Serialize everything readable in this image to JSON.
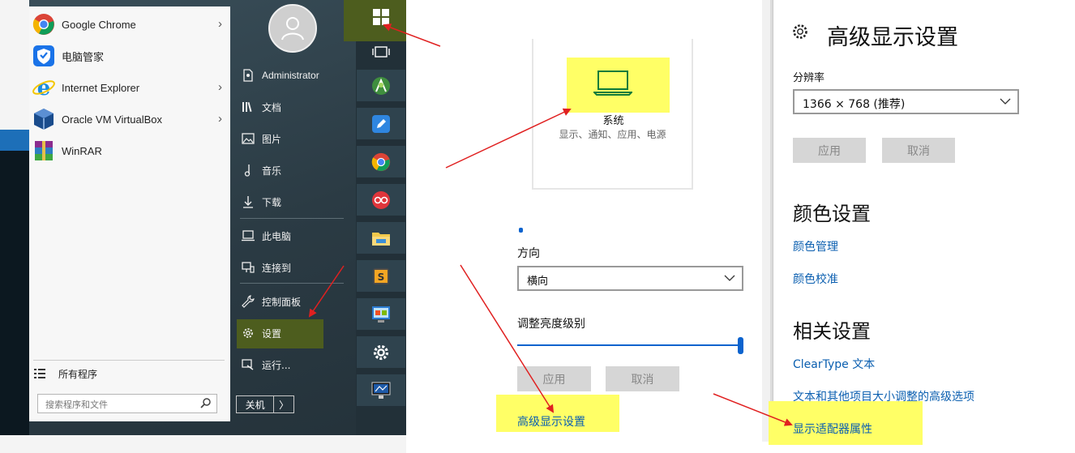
{
  "start_menu": {
    "apps": [
      {
        "label": "Google Chrome",
        "icon": "chrome-icon",
        "has_submenu": true
      },
      {
        "label": "电脑管家",
        "icon": "pc-manager-icon",
        "has_submenu": false
      },
      {
        "label": "Internet Explorer",
        "icon": "ie-icon",
        "has_submenu": true
      },
      {
        "label": "Oracle VM VirtualBox",
        "icon": "virtualbox-icon",
        "has_submenu": true
      },
      {
        "label": "WinRAR",
        "icon": "winrar-icon",
        "has_submenu": false
      }
    ],
    "all_programs": "所有程序",
    "search_placeholder": "搜索程序和文件",
    "right_items": [
      {
        "label": "Administrator",
        "icon": "user-doc-icon"
      },
      {
        "label": "文档",
        "icon": "library-icon"
      },
      {
        "label": "图片",
        "icon": "picture-icon"
      },
      {
        "label": "音乐",
        "icon": "music-icon"
      },
      {
        "label": "下载",
        "icon": "download-icon"
      },
      {
        "label": "此电脑",
        "icon": "computer-icon"
      },
      {
        "label": "连接到",
        "icon": "connect-icon"
      },
      {
        "label": "控制面板",
        "icon": "wrench-icon"
      },
      {
        "label": "设置",
        "icon": "gear-icon"
      },
      {
        "label": "运行...",
        "icon": "run-icon"
      }
    ],
    "shutdown_label": "关机",
    "shutdown_arrow": "〉"
  },
  "taskbar": {
    "icons": [
      "windows-logo-icon",
      "task-view-icon",
      "android-studio-icon",
      "feedback-icon",
      "chrome-icon",
      "app-icon",
      "file-explorer-icon",
      "sublime-icon",
      "control-panel-icon",
      "gear-icon",
      "monitor-icon"
    ]
  },
  "system_card": {
    "title": "系统",
    "subtitle": "显示、通知、应用、电源"
  },
  "display_settings": {
    "orientation_label": "方向",
    "orientation_value": "横向",
    "brightness_label": "调整亮度级别",
    "brightness_level": 1.0,
    "apply_label": "应用",
    "cancel_label": "取消",
    "advanced_link": "高级显示设置"
  },
  "advanced_settings": {
    "title": "高级显示设置",
    "resolution_label": "分辨率",
    "resolution_value": "1366 × 768 (推荐)",
    "apply_label": "应用",
    "cancel_label": "取消",
    "color_title": "颜色设置",
    "color_links": [
      "颜色管理",
      "颜色校准"
    ],
    "related_title": "相关设置",
    "related_links": [
      "ClearType 文本",
      "文本和其他项目大小调整的高级选项",
      "显示适配器属性"
    ]
  },
  "colors": {
    "highlight_yellow": "#ffff66",
    "highlight_green": "#4d5d1e",
    "link_blue": "#0b5fb0",
    "accent_blue": "#0b63ce",
    "arrow_red": "#e02020"
  }
}
